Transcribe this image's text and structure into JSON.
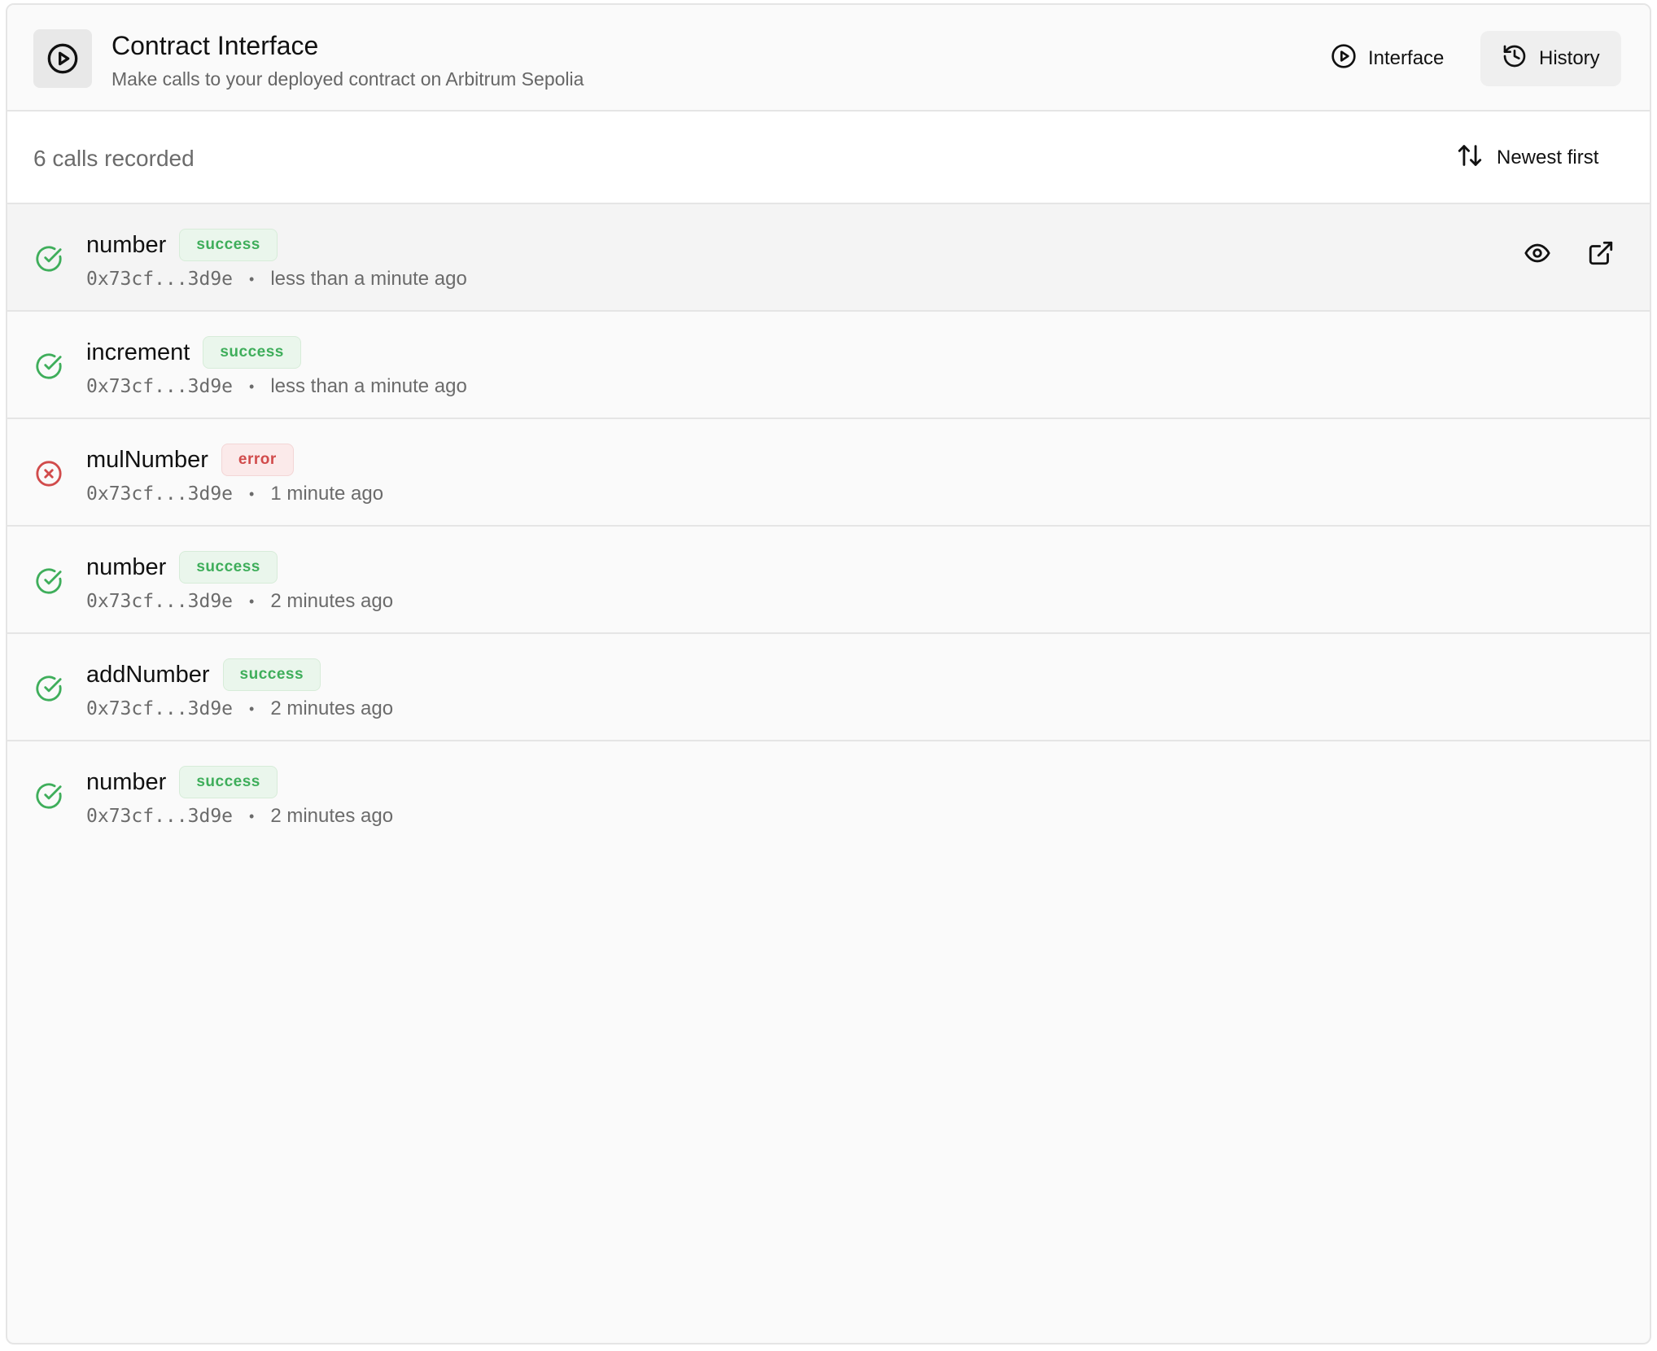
{
  "header": {
    "title": "Contract Interface",
    "subtitle": "Make calls to your deployed contract on Arbitrum Sepolia",
    "icon": "play-circle-icon",
    "nav": {
      "interface_label": "Interface",
      "history_label": "History",
      "active": "History"
    }
  },
  "toolbar": {
    "calls_count": "6 calls recorded",
    "sort_label": "Newest first"
  },
  "colors": {
    "success": "#3fae5b",
    "error": "#d14b4b"
  },
  "calls": [
    {
      "name": "number",
      "status": "success",
      "address": "0x73cf...3d9e",
      "time": "less than a minute ago"
    },
    {
      "name": "increment",
      "status": "success",
      "address": "0x73cf...3d9e",
      "time": "less than a minute ago"
    },
    {
      "name": "mulNumber",
      "status": "error",
      "address": "0x73cf...3d9e",
      "time": "1 minute ago"
    },
    {
      "name": "number",
      "status": "success",
      "address": "0x73cf...3d9e",
      "time": "2 minutes ago"
    },
    {
      "name": "addNumber",
      "status": "success",
      "address": "0x73cf...3d9e",
      "time": "2 minutes ago"
    },
    {
      "name": "number",
      "status": "success",
      "address": "0x73cf...3d9e",
      "time": "2 minutes ago"
    }
  ],
  "row_actions": [
    "eye-icon",
    "external-link-icon"
  ]
}
